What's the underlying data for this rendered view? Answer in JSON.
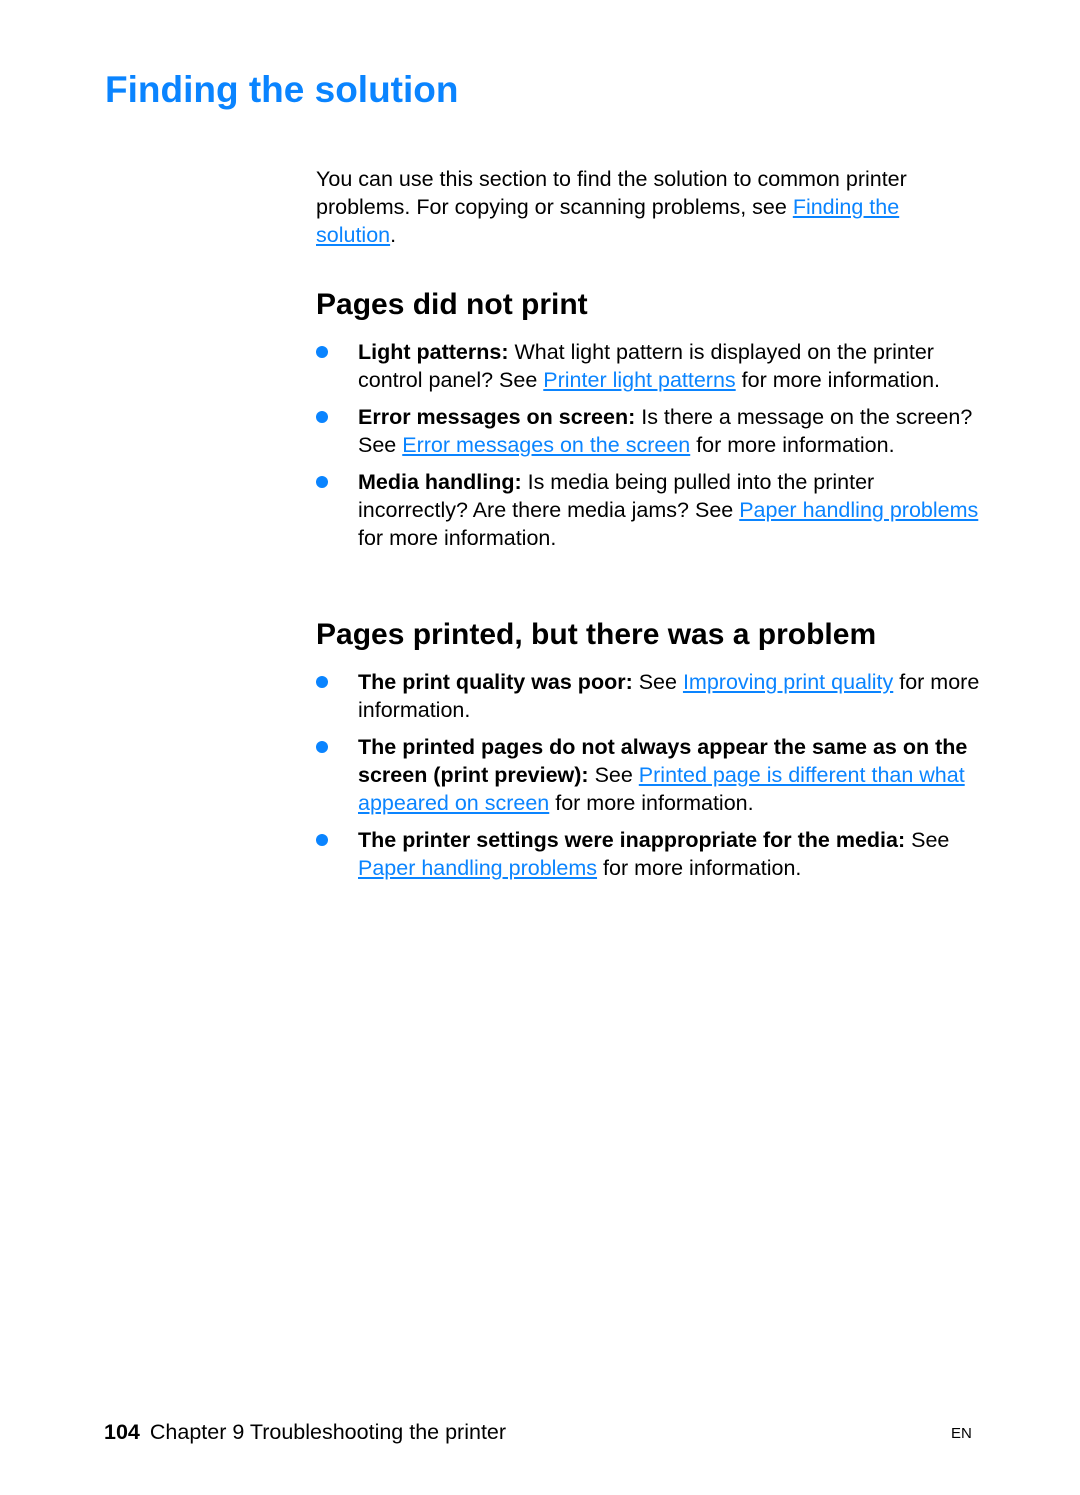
{
  "title": "Finding the solution",
  "intro": {
    "text": "You can use this section to find the solution to common printer problems. For copying or scanning problems, see ",
    "link": "Finding the solution",
    "end": "."
  },
  "sections": [
    {
      "heading": "Pages did not print",
      "items": [
        {
          "bold": "Light patterns:",
          "text": " What light pattern is displayed on the printer control panel? See ",
          "link": "Printer light patterns",
          "after": " for more information."
        },
        {
          "bold": "Error messages on screen:",
          "text": " Is there a message on the screen? See ",
          "link": "Error messages on the screen",
          "after": " for more information."
        },
        {
          "bold": "Media handling:",
          "text": " Is media being pulled into the printer incorrectly? Are there media jams? See ",
          "link": "Paper handling problems",
          "after": " for more information."
        }
      ]
    },
    {
      "heading": "Pages printed, but there was a problem",
      "items": [
        {
          "bold": "The print quality was poor:",
          "text": " See ",
          "link": "Improving print quality",
          "after": " for more information."
        },
        {
          "bold": "The printed pages do not always appear the same as on the screen (print preview):",
          "text": " See ",
          "link": "Printed page is different than what appeared on screen",
          "after": " for more information."
        },
        {
          "bold": "The printer settings were inappropriate for the media:",
          "text": " See ",
          "link": "Paper handling problems",
          "after": " for more information."
        }
      ]
    }
  ],
  "footer": {
    "page": "104",
    "chapter": "Chapter 9 Troubleshooting the printer",
    "lang": "EN"
  },
  "colors": {
    "accent": "#0a84ff"
  }
}
